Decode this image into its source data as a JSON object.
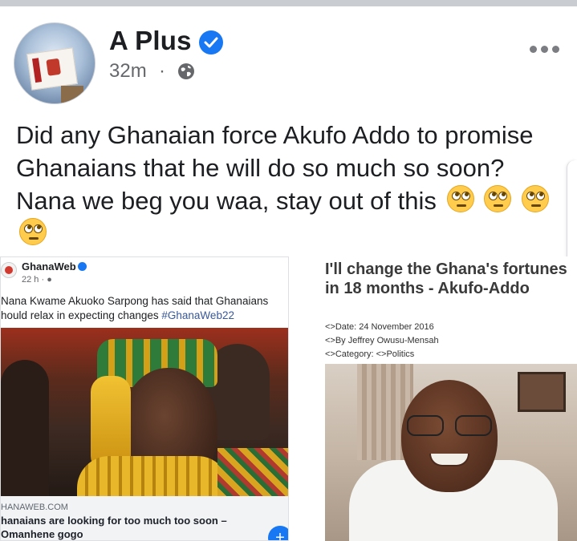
{
  "post": {
    "page_name": "A Plus",
    "time": "32m",
    "separator": "·",
    "privacy_icon": "globe-icon",
    "more_icon": "more-options-icon",
    "text": "Did any Ghanaian force Akufo Addo to promise Ghanaians that he will do so much so soon? Nana we beg you waa, stay out of this",
    "emojis": [
      "face-with-rolling-eyes",
      "face-with-rolling-eyes",
      "face-with-rolling-eyes",
      "face-with-rolling-eyes"
    ]
  },
  "shared_left": {
    "source_name": "GhanaWeb",
    "source_time": "22 h · ",
    "caption_text": "Nana Kwame Akuoko Sarpong has said that Ghanaians hould relax in expecting changes ",
    "hashtag": "#GhanaWeb22",
    "link_domain": "HANAWEB.COM",
    "link_title": "hanaians are looking for too much too soon – Omanhene gogo",
    "fab_label": "+"
  },
  "shared_right": {
    "title": "I'll change the Ghana's fortunes in 18 months - Akufo-Addo",
    "meta_date": "<>Date: 24 November 2016",
    "meta_author": "<>By Jeffrey Owusu-Mensah",
    "meta_category": "<>Category: <>Politics"
  },
  "colors": {
    "verified_blue": "#1877f2",
    "text_primary": "#1c1e21",
    "text_secondary": "#65676b",
    "hashtag": "#385898"
  }
}
